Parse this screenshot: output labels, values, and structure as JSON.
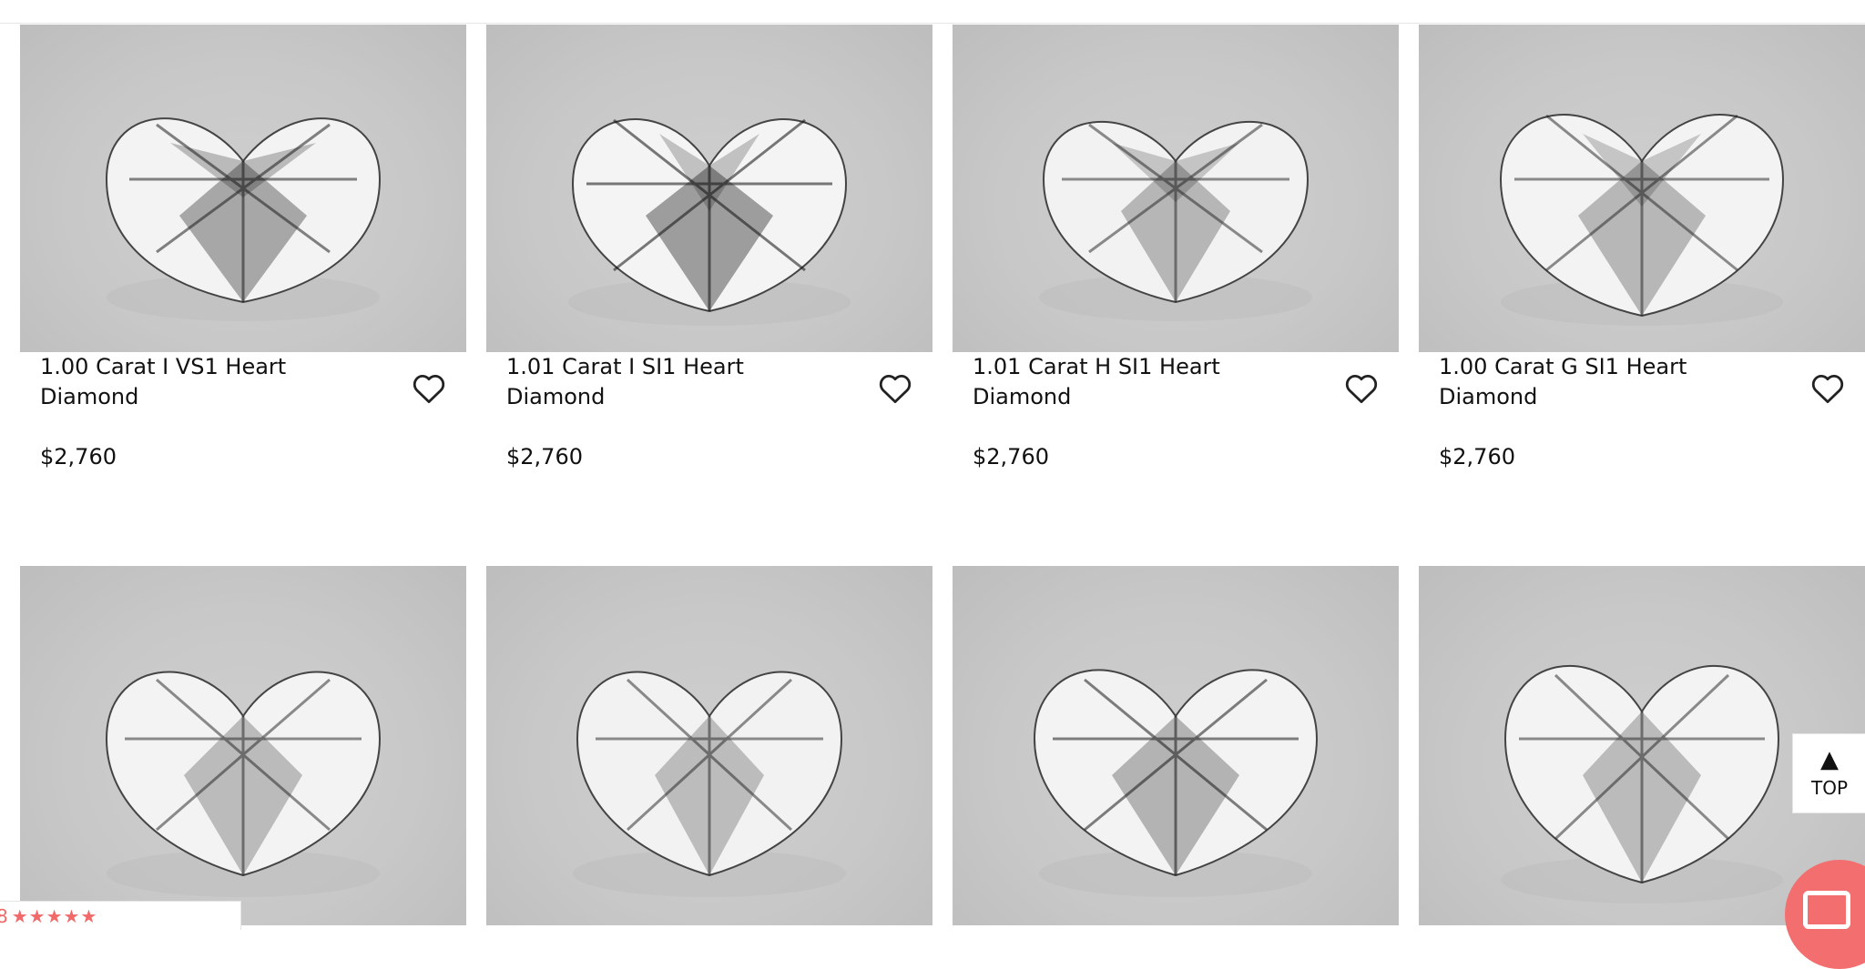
{
  "products_row1": [
    {
      "title": "1.00 Carat I VS1 Heart Diamond",
      "price": "$2,760"
    },
    {
      "title": "1.01 Carat I SI1 Heart Diamond",
      "price": "$2,760"
    },
    {
      "title": "1.01 Carat H SI1 Heart Diamond",
      "price": "$2,760"
    },
    {
      "title": "1.00 Carat G SI1 Heart Diamond",
      "price": "$2,760"
    }
  ],
  "products_row2_count": 4,
  "icons": {
    "favorite": "heart-outline-icon",
    "back_to_top": "triangle-up-icon",
    "chat": "chat-icon",
    "rating": "star-icon"
  },
  "ui": {
    "back_to_top_label": "TOP",
    "reviews_count_fragment": "8",
    "rating_stars": "★★★★★"
  },
  "colors": {
    "accent": "#f36f6f",
    "image_bg": "#c8c8c8",
    "text": "#111111"
  }
}
